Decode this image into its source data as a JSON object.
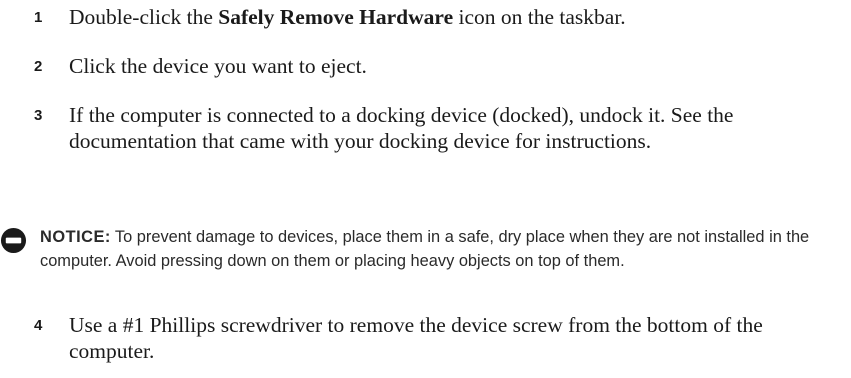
{
  "steps": [
    {
      "number": "1",
      "text_before": "Double-click the ",
      "text_bold": "Safely Remove Hardware",
      "text_after": " icon on the taskbar."
    },
    {
      "number": "2",
      "text": "Click the device you want to eject."
    },
    {
      "number": "3",
      "text": "If the computer is connected to a docking device (docked), undock it. See the documentation that came with your docking device for instructions."
    },
    {
      "number": "4",
      "text": "Use a #1 Phillips screwdriver to remove the device screw from the bottom of the computer."
    }
  ],
  "notice": {
    "icon": "notice-icon",
    "label": "NOTICE:",
    "text": "To prevent damage to devices, place them in a safe, dry place when they are not installed in the computer. Avoid pressing down on them or placing heavy objects on top of them."
  }
}
